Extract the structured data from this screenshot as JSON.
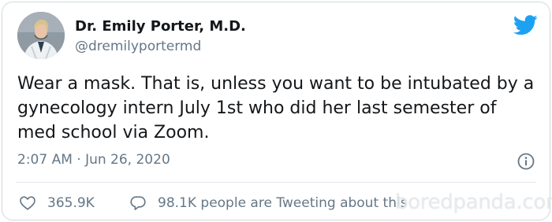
{
  "author": {
    "name": "Dr. Emily Porter, M.D.",
    "handle": "@dremilyportermd"
  },
  "tweet": {
    "text": "Wear a mask. That is, unless you want to be intubated by a gynecology intern July 1st who did her last semester of med school via Zoom.",
    "timestamp": "2:07 AM · Jun 26, 2020"
  },
  "actions": {
    "likes": "365.9K",
    "conversation": "98.1K people are Tweeting about this"
  },
  "watermark": "boredpanda.com",
  "colors": {
    "twitter_blue": "#1da1f2",
    "secondary_text": "#657786",
    "primary_text": "#14171a"
  },
  "icons": [
    "twitter-bird-icon",
    "info-icon",
    "heart-icon",
    "speech-bubble-icon"
  ]
}
